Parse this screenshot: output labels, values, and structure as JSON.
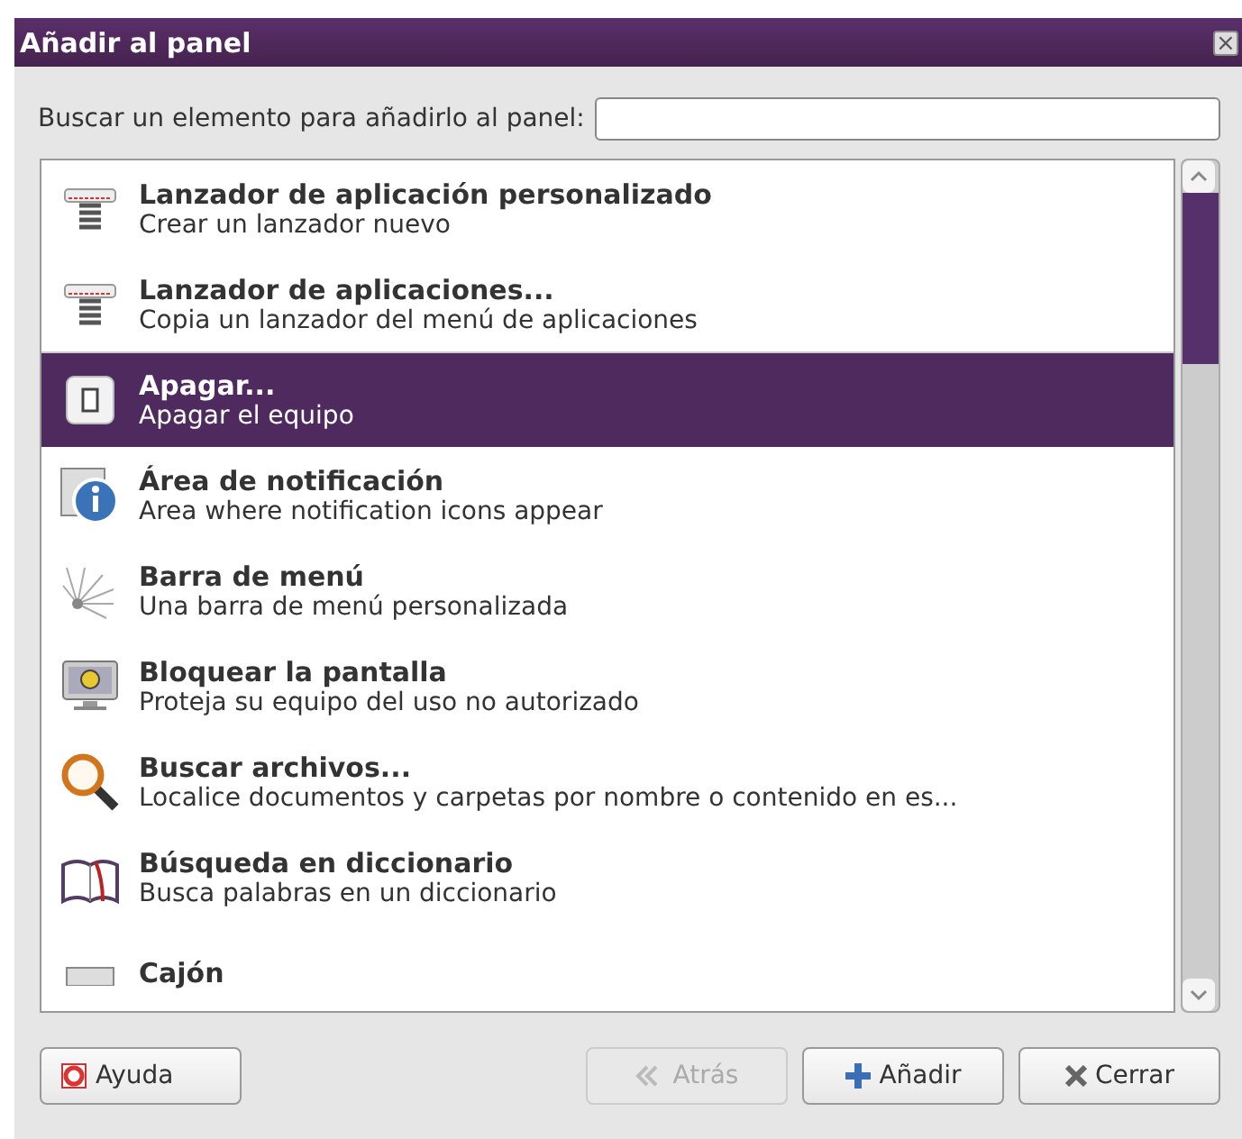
{
  "window": {
    "title": "Añadir al panel",
    "close": "×"
  },
  "search": {
    "label": "Buscar un elemento para añadirlo al panel:"
  },
  "items": [
    {
      "title": "Lanzador de aplicación personalizado",
      "description": "Crear un lanzador nuevo",
      "selected": false
    },
    {
      "title": "Lanzador de aplicaciones...",
      "description": "Copia un lanzador del menú de aplicaciones",
      "selected": false
    },
    {
      "title": "Apagar...",
      "description": "Apagar el equipo",
      "selected": true
    },
    {
      "title": "Área de notificación",
      "description": "Area where notification icons appear",
      "selected": false
    },
    {
      "title": "Barra de menú",
      "description": "Una barra de menú personalizada",
      "selected": false
    },
    {
      "title": "Bloquear la pantalla",
      "description": "Proteja su equipo del uso no autorizado",
      "selected": false
    },
    {
      "title": "Buscar archivos...",
      "description": "Localice documentos y carpetas por nombre o contenido en es...",
      "selected": false
    },
    {
      "title": "Búsqueda en diccionario",
      "description": "Busca palabras en un diccionario",
      "selected": false
    },
    {
      "title": "Cajón",
      "selected": false
    }
  ],
  "buttons": [
    {
      "kind": "help",
      "label": "Ayuda",
      "disabled": false
    },
    {
      "kind": "back",
      "label": "Atrás",
      "disabled": true
    },
    {
      "kind": "add",
      "label": "Añadir",
      "disabled": false
    },
    {
      "kind": "close",
      "label": "Cerrar",
      "disabled": false
    }
  ]
}
